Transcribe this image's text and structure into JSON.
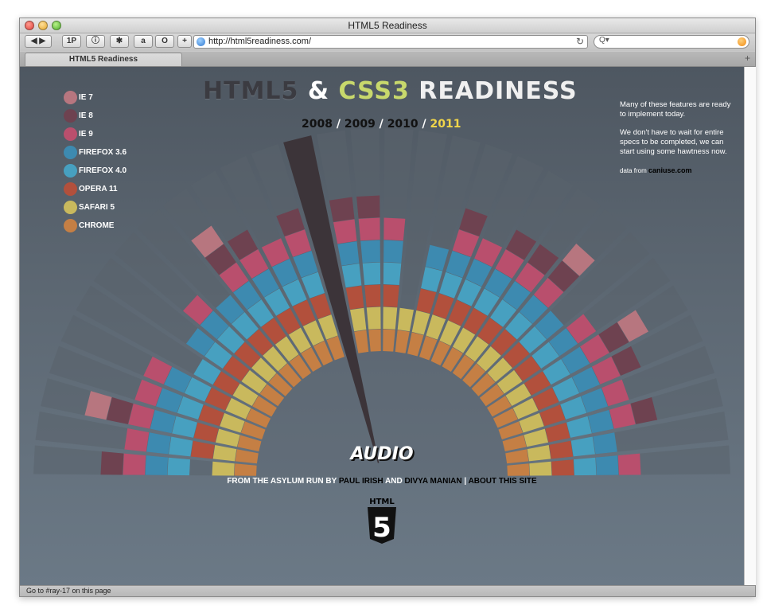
{
  "window": {
    "title": "HTML5 Readiness",
    "url": "http://html5readiness.com/",
    "tab_label": "HTML5 Readiness",
    "status_text": "Go to #ray-17 on this page"
  },
  "toolbar": {
    "buttons": [
      "1P",
      "@",
      "a",
      "O",
      "+"
    ],
    "search_placeholder": "Q▾"
  },
  "page": {
    "headline": {
      "part1": "HTML5",
      "part2": "&",
      "part3": "CSS3",
      "part4": "READINESS"
    },
    "years": {
      "y1": "2008",
      "y2": "2009",
      "y3": "2010",
      "y4": "2011",
      "sep": " / "
    },
    "side_note": {
      "p1": "Many of these features are ready to implement today.",
      "p2": "We don't have to wait for entire specs to be completed, we can start using some hawtness now.",
      "data_from": "data from",
      "source": "caniuse.com"
    },
    "selected_feature": "AUDIO",
    "credits": {
      "prefix": "FROM THE ASYLUM RUN BY",
      "author1": "PAUL IRISH",
      "and": "AND",
      "author2": "DIVYA MANIAN",
      "sep": "|",
      "about": "ABOUT THIS SITE"
    },
    "logo_text": "HTML",
    "logo_digit": "5"
  },
  "legend": [
    {
      "label": "IE 7",
      "color": "#b7767f"
    },
    {
      "label": "IE 8",
      "color": "#6e4250"
    },
    {
      "label": "IE 9",
      "color": "#b94f6d"
    },
    {
      "label": "FIREFOX 3.6",
      "color": "#3d8ab0"
    },
    {
      "label": "FIREFOX 4.0",
      "color": "#47a0c0"
    },
    {
      "label": "OPERA 11",
      "color": "#b2503c"
    },
    {
      "label": "SAFARI 5",
      "color": "#c9b95d"
    },
    {
      "label": "CHROME",
      "color": "#c57f44"
    }
  ],
  "chart_data": {
    "type": "radial-stacked-bar",
    "series_colors": [
      "#c57f44",
      "#c9b95d",
      "#b2503c",
      "#47a0c0",
      "#3d8ab0",
      "#b94f6d",
      "#6e4250",
      "#b7767f"
    ],
    "series": [
      "CHROME",
      "SAFARI 5",
      "OPERA 11",
      "FIREFOX 4.0",
      "FIREFOX 3.6",
      "IE 9",
      "IE 8",
      "IE 7"
    ],
    "rays": [
      [
        1,
        1,
        0,
        1,
        1,
        1,
        1,
        0
      ],
      [
        1,
        1,
        1,
        1,
        1,
        1,
        0,
        0
      ],
      [
        1,
        1,
        1,
        1,
        1,
        1,
        1,
        1
      ],
      [
        1,
        1,
        1,
        1,
        1,
        1,
        0,
        0
      ],
      [
        1,
        1,
        1,
        1,
        1,
        1,
        0,
        0
      ],
      [
        1,
        1,
        1,
        1,
        0,
        0,
        0,
        0
      ],
      [
        1,
        1,
        1,
        1,
        1,
        0,
        0,
        0
      ],
      [
        1,
        1,
        1,
        1,
        1,
        1,
        0,
        0
      ],
      [
        1,
        1,
        1,
        1,
        1,
        0,
        0,
        0
      ],
      [
        1,
        1,
        1,
        1,
        1,
        1,
        1,
        1
      ],
      [
        1,
        1,
        1,
        1,
        1,
        1,
        1,
        0
      ],
      [
        1,
        1,
        1,
        1,
        1,
        1,
        0,
        0
      ],
      [
        1,
        1,
        1,
        1,
        1,
        1,
        1,
        0
      ],
      [
        0,
        0,
        0,
        0,
        0,
        0,
        0,
        0
      ],
      [
        1,
        1,
        1,
        1,
        1,
        1,
        1,
        0
      ],
      [
        1,
        1,
        1,
        1,
        1,
        1,
        1,
        0
      ],
      [
        1,
        1,
        1,
        1,
        1,
        1,
        0,
        0
      ],
      [
        1,
        1,
        0,
        0,
        0,
        0,
        0,
        0
      ],
      [
        1,
        1,
        1,
        1,
        1,
        0,
        0,
        0
      ],
      [
        1,
        1,
        1,
        1,
        1,
        1,
        1,
        0
      ],
      [
        1,
        1,
        1,
        1,
        1,
        1,
        0,
        0
      ],
      [
        1,
        1,
        1,
        1,
        1,
        1,
        1,
        0
      ],
      [
        1,
        1,
        1,
        1,
        1,
        1,
        1,
        0
      ],
      [
        1,
        1,
        1,
        1,
        1,
        1,
        1,
        1
      ],
      [
        1,
        1,
        1,
        1,
        1,
        0,
        0,
        0
      ],
      [
        1,
        1,
        1,
        1,
        1,
        1,
        0,
        0
      ],
      [
        1,
        1,
        1,
        1,
        1,
        1,
        1,
        1
      ],
      [
        1,
        1,
        1,
        1,
        1,
        1,
        1,
        0
      ],
      [
        1,
        1,
        1,
        1,
        1,
        1,
        0,
        0
      ],
      [
        1,
        1,
        1,
        1,
        1,
        1,
        1,
        0
      ],
      [
        1,
        1,
        1,
        1,
        1,
        0,
        0,
        0
      ],
      [
        1,
        1,
        1,
        1,
        1,
        1,
        0,
        0
      ]
    ]
  }
}
